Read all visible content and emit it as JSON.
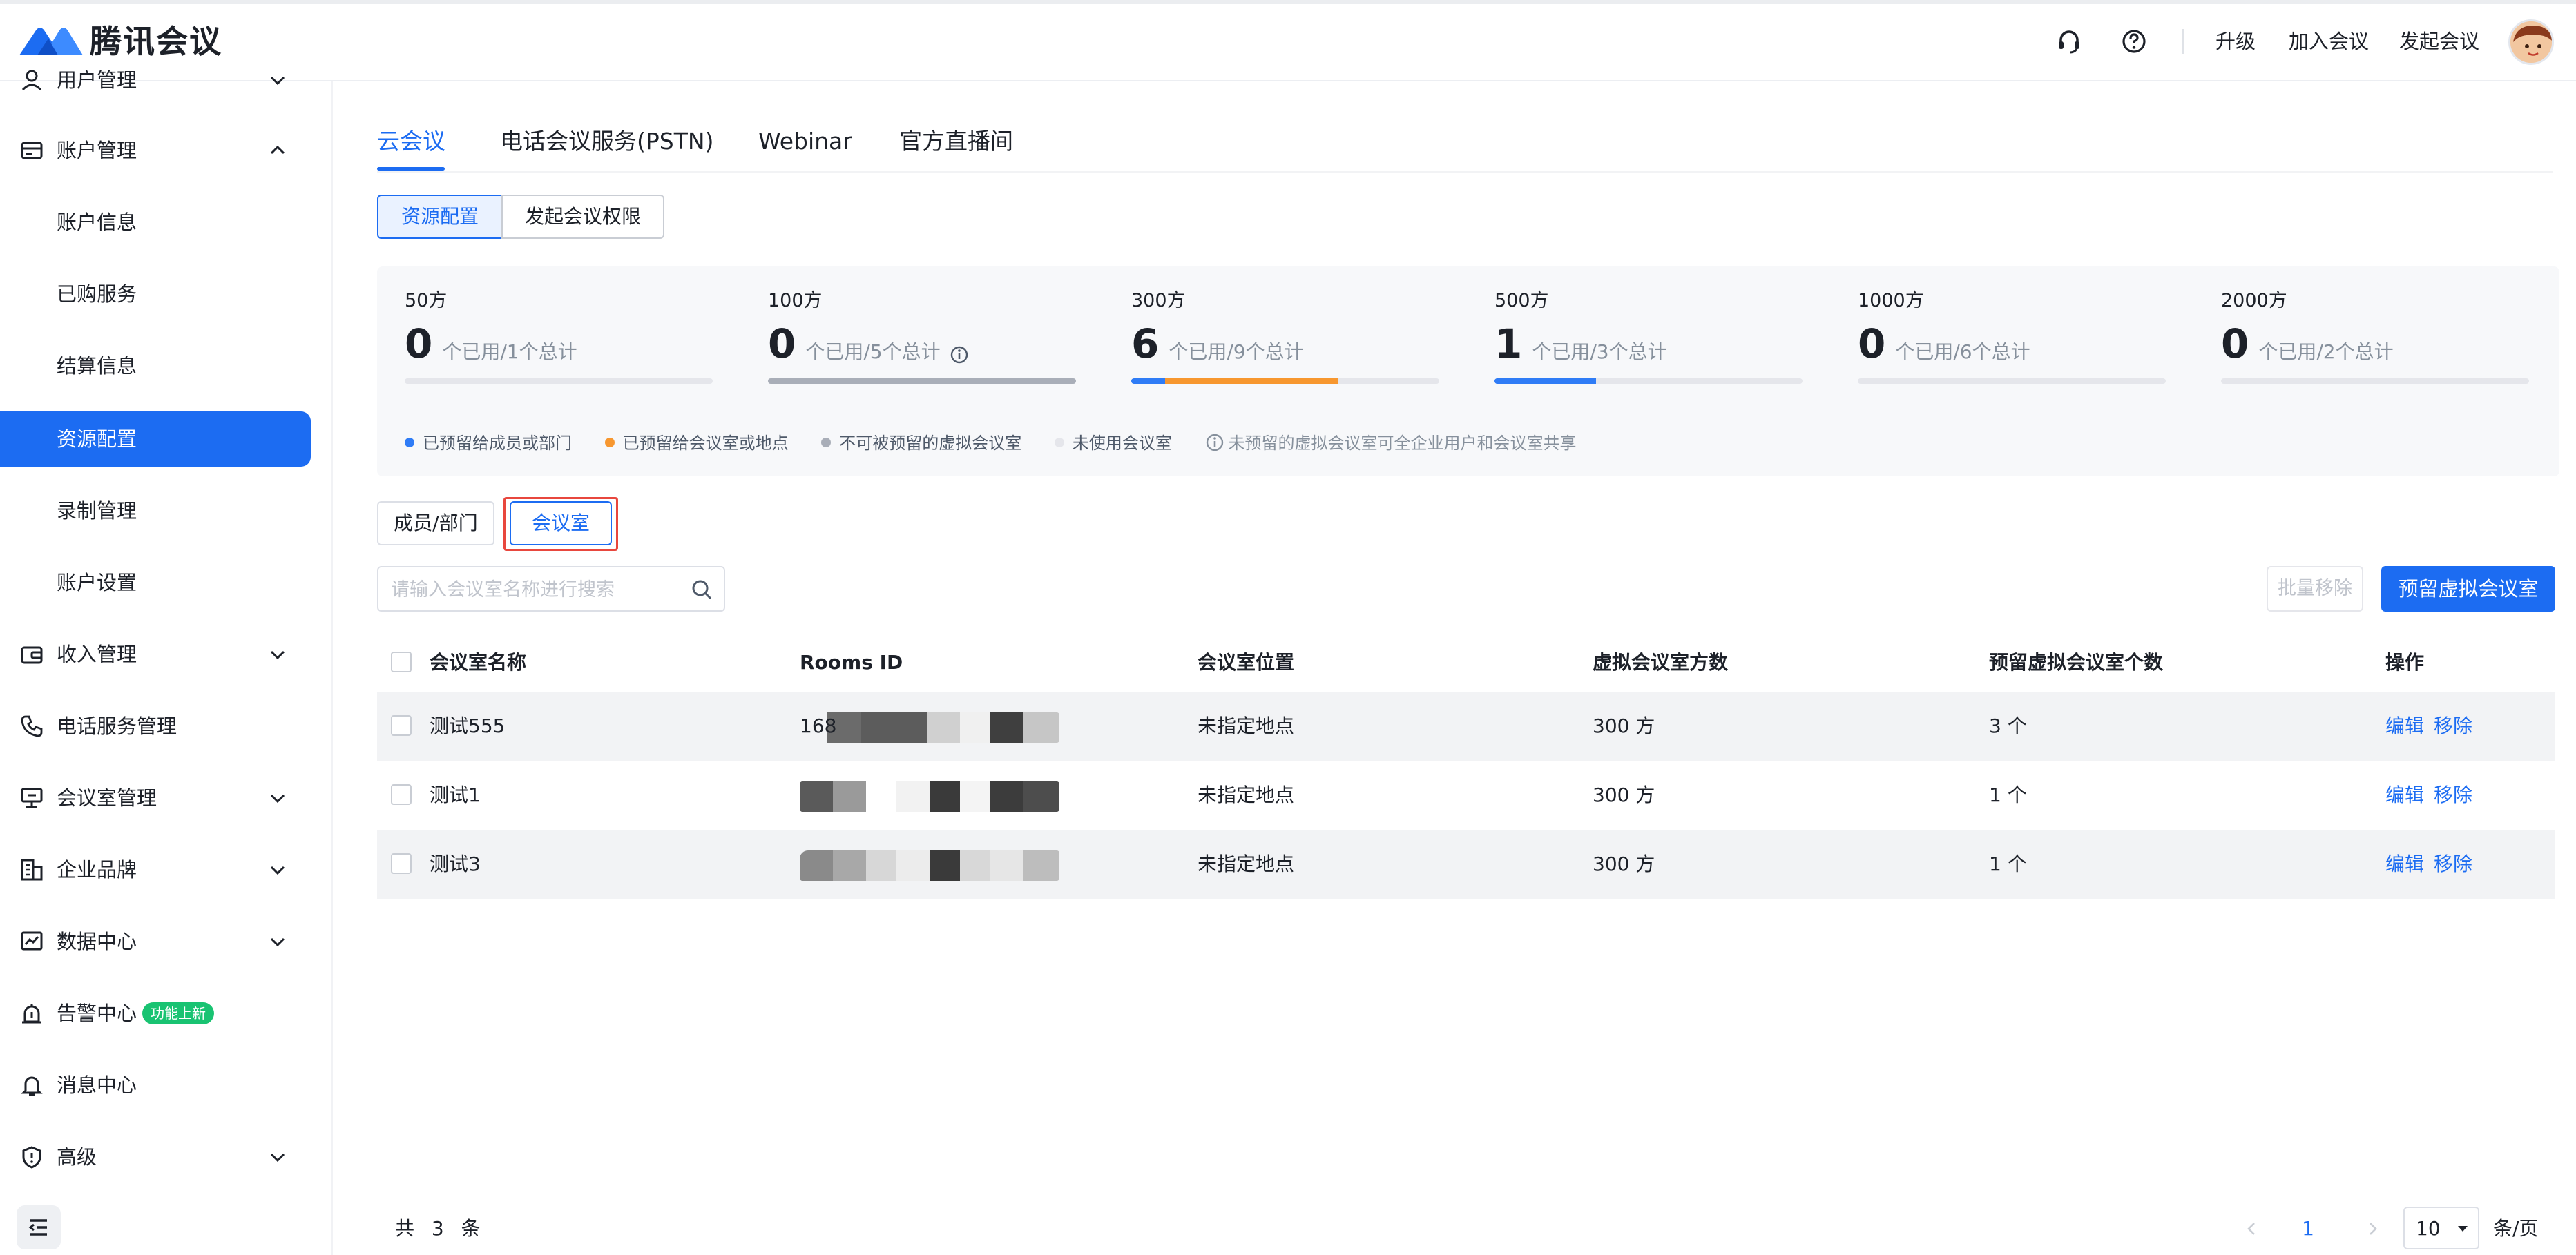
{
  "app": {
    "logo_text": "腾讯会议"
  },
  "header": {
    "links": [
      "升级",
      "加入会议",
      "发起会议"
    ]
  },
  "sidebar": {
    "items": [
      {
        "label": "用户管理",
        "icon": "users-icon",
        "expandable": true
      },
      {
        "label": "账户管理",
        "icon": "account-card-icon",
        "expandable": true,
        "expanded": true
      },
      {
        "label": "账户信息",
        "sub": true
      },
      {
        "label": "已购服务",
        "sub": true
      },
      {
        "label": "结算信息",
        "sub": true
      },
      {
        "label": "资源配置",
        "sub": true,
        "active": true
      },
      {
        "label": "录制管理",
        "sub": true
      },
      {
        "label": "账户设置",
        "sub": true
      },
      {
        "label": "收入管理",
        "icon": "wallet-icon",
        "expandable": true
      },
      {
        "label": "电话服务管理",
        "icon": "phone-icon"
      },
      {
        "label": "会议室管理",
        "icon": "meeting-room-icon",
        "expandable": true
      },
      {
        "label": "企业品牌",
        "icon": "building-icon",
        "expandable": true
      },
      {
        "label": "数据中心",
        "icon": "chart-line-icon",
        "expandable": true
      },
      {
        "label": "告警中心",
        "icon": "alarm-icon",
        "badge": "功能上新"
      },
      {
        "label": "消息中心",
        "icon": "bell-icon"
      },
      {
        "label": "高级",
        "icon": "shield-icon",
        "expandable": true
      }
    ]
  },
  "tabs": [
    "云会议",
    "电话会议服务(PSTN)",
    "Webinar",
    "官方直播间"
  ],
  "segments": [
    "资源配置",
    "发起会议权限"
  ],
  "stats": [
    {
      "caption": "50方",
      "value": "0",
      "desc": "个已用/1个总计",
      "info": false,
      "usage": {
        "member": 0,
        "room": 0,
        "nonreserve": 0
      }
    },
    {
      "caption": "100方",
      "value": "0",
      "desc": "个已用/5个总计",
      "info": true,
      "usage": {
        "member": 0,
        "room": 0,
        "nonreserve": 1.0
      }
    },
    {
      "caption": "300方",
      "value": "6",
      "desc": "个已用/9个总计",
      "info": false,
      "usage": {
        "member": 0.11,
        "room": 0.56,
        "nonreserve": 0
      }
    },
    {
      "caption": "500方",
      "value": "1",
      "desc": "个已用/3个总计",
      "info": false,
      "usage": {
        "member": 0.33,
        "room": 0,
        "nonreserve": 0
      }
    },
    {
      "caption": "1000方",
      "value": "0",
      "desc": "个已用/6个总计",
      "info": false,
      "usage": {
        "member": 0,
        "room": 0,
        "nonreserve": 0
      }
    },
    {
      "caption": "2000方",
      "value": "0",
      "desc": "个已用/2个总计",
      "info": false,
      "usage": {
        "member": 0,
        "room": 0,
        "nonreserve": 0
      }
    }
  ],
  "legend": [
    {
      "label": "已预留给成员或部门",
      "color": "#2f7cf6"
    },
    {
      "label": "已预留给会议室或地点",
      "color": "#f7972f"
    },
    {
      "label": "不可被预留的虚拟会议室",
      "color": "#a9aeb8"
    },
    {
      "label": "未使用会议室",
      "color": "#e5e6eb"
    }
  ],
  "legend_note": "未预留的虚拟会议室可全企业用户和会议室共享",
  "sub_tabs": [
    "成员/部门",
    "会议室"
  ],
  "search": {
    "placeholder": "请输入会议室名称进行搜索"
  },
  "buttons": {
    "batch_remove": "批量移除",
    "reserve": "预留虚拟会议室"
  },
  "table": {
    "columns": [
      "会议室名称",
      "Rooms ID",
      "会议室位置",
      "虚拟会议室方数",
      "预留虚拟会议室个数",
      "操作"
    ],
    "rows": [
      {
        "name": "测试555",
        "rooms_id_prefix": "168",
        "location": "未指定地点",
        "capacity": "300 方",
        "count": "3 个",
        "actions": [
          "编辑",
          "移除"
        ]
      },
      {
        "name": "测试1",
        "rooms_id_prefix": "",
        "location": "未指定地点",
        "capacity": "300 方",
        "count": "1 个",
        "actions": [
          "编辑",
          "移除"
        ]
      },
      {
        "name": "测试3",
        "rooms_id_prefix": "",
        "location": "未指定地点",
        "capacity": "300 方",
        "count": "1 个",
        "actions": [
          "编辑",
          "移除"
        ]
      }
    ]
  },
  "pagination": {
    "total": "共 3 条",
    "current": "1",
    "page_size": "10",
    "unit": "条/页"
  },
  "colors": {
    "accent": "#1c6cf2",
    "badge": "#19c372",
    "highlight": "#e8473e"
  }
}
